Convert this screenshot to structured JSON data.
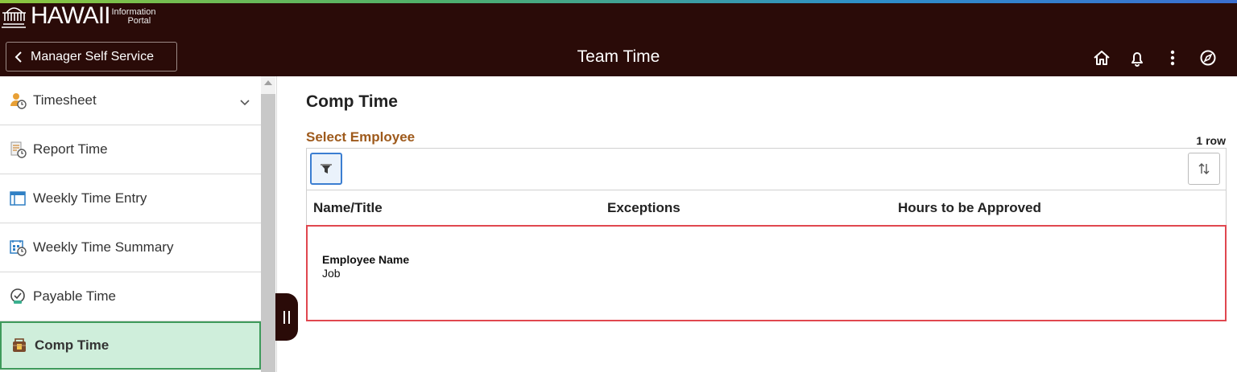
{
  "header": {
    "logo_main": "HAWAII",
    "logo_sub_line1": "Information",
    "logo_sub_line2": "Portal",
    "back_label": "Manager Self Service",
    "title": "Team Time",
    "icons": [
      "home-icon",
      "bell-icon",
      "more-vertical-icon",
      "compass-icon"
    ]
  },
  "sidebar": {
    "items": [
      {
        "label": "Timesheet",
        "icon": "timesheet-icon",
        "expandable": true
      },
      {
        "label": "Report Time",
        "icon": "report-time-icon"
      },
      {
        "label": "Weekly Time Entry",
        "icon": "weekly-entry-icon"
      },
      {
        "label": "Weekly Time Summary",
        "icon": "calendar-clock-icon"
      },
      {
        "label": "Payable Time",
        "icon": "payable-time-icon"
      },
      {
        "label": "Comp Time",
        "icon": "comp-time-icon",
        "active": true
      }
    ]
  },
  "main": {
    "page_title": "Comp Time",
    "section_title": "Select Employee",
    "row_count": "1 row",
    "columns": [
      "Name/Title",
      "Exceptions",
      "Hours to be Approved"
    ],
    "rows": [
      {
        "name": "Employee Name",
        "job": "Job"
      }
    ]
  },
  "colors": {
    "header_bg": "#2a0b08",
    "section_title": "#9e5a1c",
    "active_item_bg": "#cfeedb",
    "active_item_border": "#3e9a5b",
    "row_highlight": "#e0474f",
    "filter_accent": "#3b7ed1"
  }
}
